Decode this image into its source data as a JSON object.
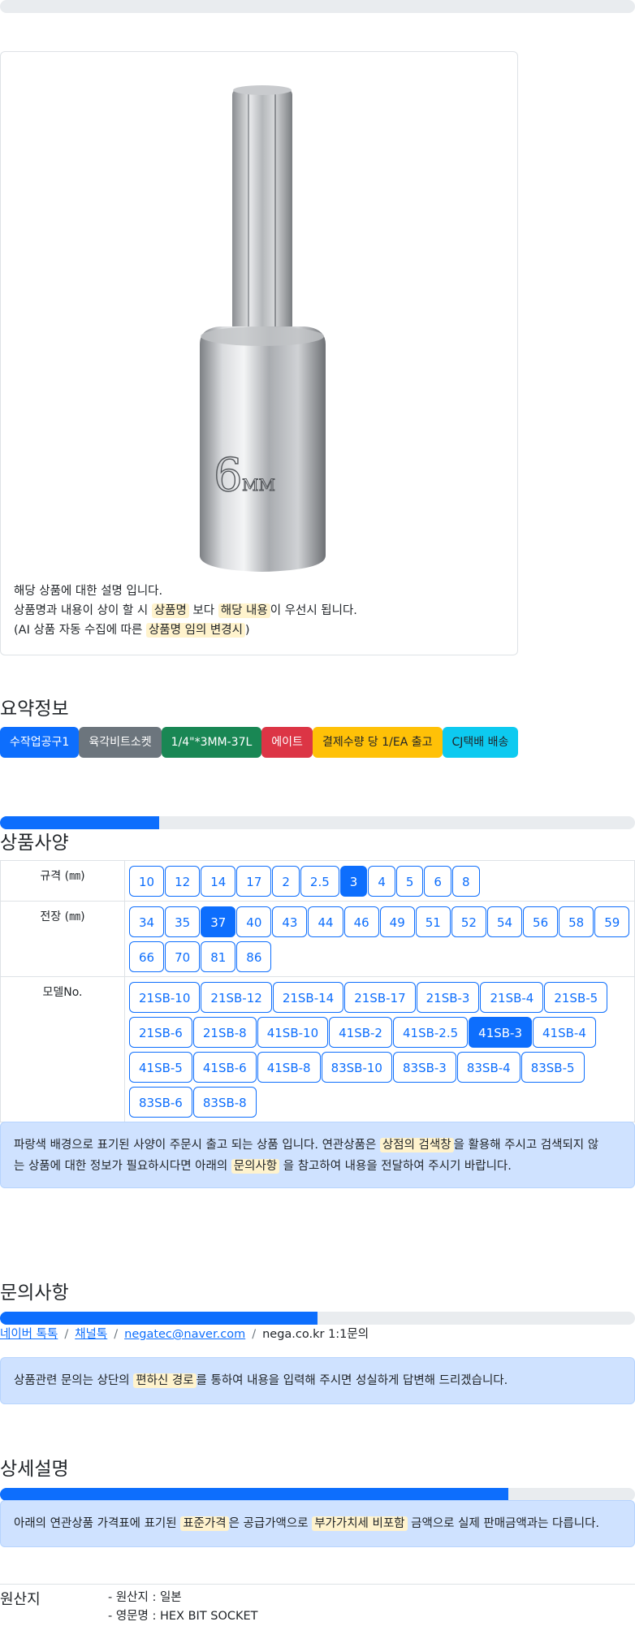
{
  "description": {
    "line1": "해당 상품에 대한 설명 입니다.",
    "line2_a": "상품명과 내용이 상이 할 시 ",
    "line2_hl1": "상품명",
    "line2_b": " 보다 ",
    "line2_hl2": "해당 내용",
    "line2_c": "이 우선시 됩니다.",
    "line3_a": "(AI 상품 자동 수집에 따른 ",
    "line3_hl": "상품명 임의 변경시",
    "line3_b": ")",
    "image_marking": "6mm"
  },
  "summary": {
    "title": "요약정보",
    "badges": [
      {
        "label": "수작업공구1",
        "color": "#0d6efd"
      },
      {
        "label": "육각비트소켓",
        "color": "#6c757d"
      },
      {
        "label": "1/4\"*3MM-37L",
        "color": "#198754"
      },
      {
        "label": "에이트",
        "color": "#dc3545"
      },
      {
        "label": "결제수량 당 1/EA 출고",
        "color": "#ffc107"
      },
      {
        "label": "CJ택배 배송",
        "color": "#0dcaf0"
      }
    ]
  },
  "spec": {
    "progress": 0.25,
    "title": "상품사양",
    "rows": [
      {
        "label": "규격 (㎜)",
        "options": [
          "10",
          "12",
          "14",
          "17",
          "2",
          "2.5",
          "3",
          "4",
          "5",
          "6",
          "8"
        ],
        "selected": "3"
      },
      {
        "label": "전장 (㎜)",
        "options": [
          "34",
          "35",
          "37",
          "40",
          "43",
          "44",
          "46",
          "49",
          "51",
          "52",
          "54",
          "56",
          "58",
          "59",
          "66",
          "70",
          "81",
          "86"
        ],
        "selected": "37"
      },
      {
        "label": "모델No.",
        "options": [
          "21SB-10",
          "21SB-12",
          "21SB-14",
          "21SB-17",
          "21SB-3",
          "21SB-4",
          "21SB-5",
          "21SB-6",
          "21SB-8",
          "41SB-10",
          "41SB-2",
          "41SB-2.5",
          "41SB-3",
          "41SB-4",
          "41SB-5",
          "41SB-6",
          "41SB-8",
          "83SB-10",
          "83SB-3",
          "83SB-4",
          "83SB-5",
          "83SB-6",
          "83SB-8"
        ],
        "selected": "41SB-3"
      }
    ],
    "notice_a": "파랑색 배경으로 표기된 사양이 주문시 출고 되는 상품 입니다. 연관상품은 ",
    "notice_hl1": "상점의 검색창",
    "notice_b": "을 활용해 주시고 검색되지 않",
    "notice_c": "는 상품에 대한 정보가 필요하시다면 아래의 ",
    "notice_hl2": "문의사항",
    "notice_d": " 을 참고하여 내용을 전달하여 주시기 바랍니다."
  },
  "inquiry": {
    "title": "문의사항",
    "progress": 0.5,
    "links": [
      "네이버 톡톡",
      "채널톡",
      "negatec@naver.com"
    ],
    "plain": "nega.co.kr 1:1문의",
    "sep": "/",
    "notice_a": "상품관련 문의는 상단의 ",
    "notice_hl": "편하신 경로",
    "notice_b": "를 통하여 내용을 입력해 주시면 성실하게 답변해 드리겠습니다."
  },
  "detail": {
    "title": "상세설명",
    "progress": 0.8,
    "notice_a": "아래의 연관상품 가격표에 표기된 ",
    "notice_hl1": "표준가격",
    "notice_b": "은 공급가액으로 ",
    "notice_hl2": "부가가치세 비포함",
    "notice_c": " 금액으로 실제 판매금액과는 다릅니다."
  },
  "origin": {
    "label": "원산지",
    "items": [
      "- 원산지 : 일본",
      "- 영문명 : HEX BIT SOCKET"
    ]
  }
}
